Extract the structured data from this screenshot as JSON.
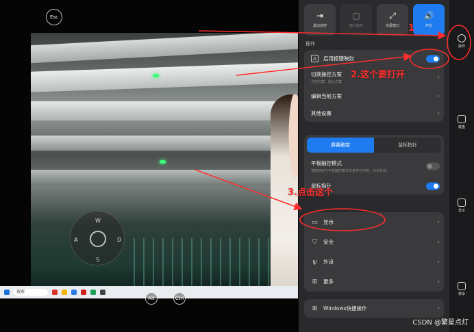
{
  "remote": {
    "esc_label": "Esc",
    "alt_label": "Alt",
    "ctrl_label": "Ctrl",
    "joystick": {
      "up": "W",
      "left": "A",
      "right": "D",
      "down": "S"
    },
    "taskbar_search": "搜索"
  },
  "quick_actions": [
    {
      "label": "退出远控",
      "icon": "exit-icon",
      "state": "normal"
    },
    {
      "label": "窗口放开",
      "icon": "window-icon",
      "state": "disabled"
    },
    {
      "label": "全屏窗口",
      "icon": "fullscreen-icon",
      "state": "normal"
    },
    {
      "label": "声音",
      "icon": "speaker-icon",
      "state": "active"
    }
  ],
  "section_title": "操作",
  "ops_card": {
    "key_mapping": {
      "label": "启用按键映射",
      "enabled": true
    },
    "switch_scheme": {
      "label": "切换操控方案",
      "sub": "当前方案：默认方案"
    },
    "edit_scheme": {
      "label": "编辑当前方案"
    },
    "other_settings": {
      "label": "其他设置"
    }
  },
  "touch_card": {
    "tabs": [
      {
        "label": "屏幕触控",
        "selected": true
      },
      {
        "label": "鼠标指针",
        "selected": false
      }
    ],
    "tablet_mode": {
      "label": "平板触控模式",
      "sub": "按键映射与平板触控模式多身存在冲突，无法开启。",
      "enabled": false
    },
    "hidden_row": {
      "label": "鼠标指针",
      "enabled": true
    }
  },
  "settings_card": [
    {
      "label": "显示",
      "icon": "monitor-icon"
    },
    {
      "label": "安全",
      "icon": "shield-icon"
    },
    {
      "label": "外设",
      "icon": "usb-icon"
    },
    {
      "label": "更多",
      "icon": "grid-icon"
    }
  ],
  "windows_card": {
    "label": "Windows快捷操作",
    "icon": "windows-icon"
  },
  "rail": [
    {
      "label": "操作",
      "icon": "controller-icon"
    },
    {
      "label": "键盘",
      "icon": "keyboard-icon"
    },
    {
      "label": "显示",
      "icon": "screen-icon"
    },
    {
      "label": "菜单",
      "icon": "menu-icon"
    }
  ],
  "annotations": {
    "step1": "1",
    "step2": "2.这个要打开",
    "step3": "3.点击这个"
  },
  "watermark": "CSDN @繁星点灯",
  "colors": {
    "accent": "#1f7cf0",
    "annotation": "#ff2d2d",
    "panel": "#2a2a2c"
  }
}
